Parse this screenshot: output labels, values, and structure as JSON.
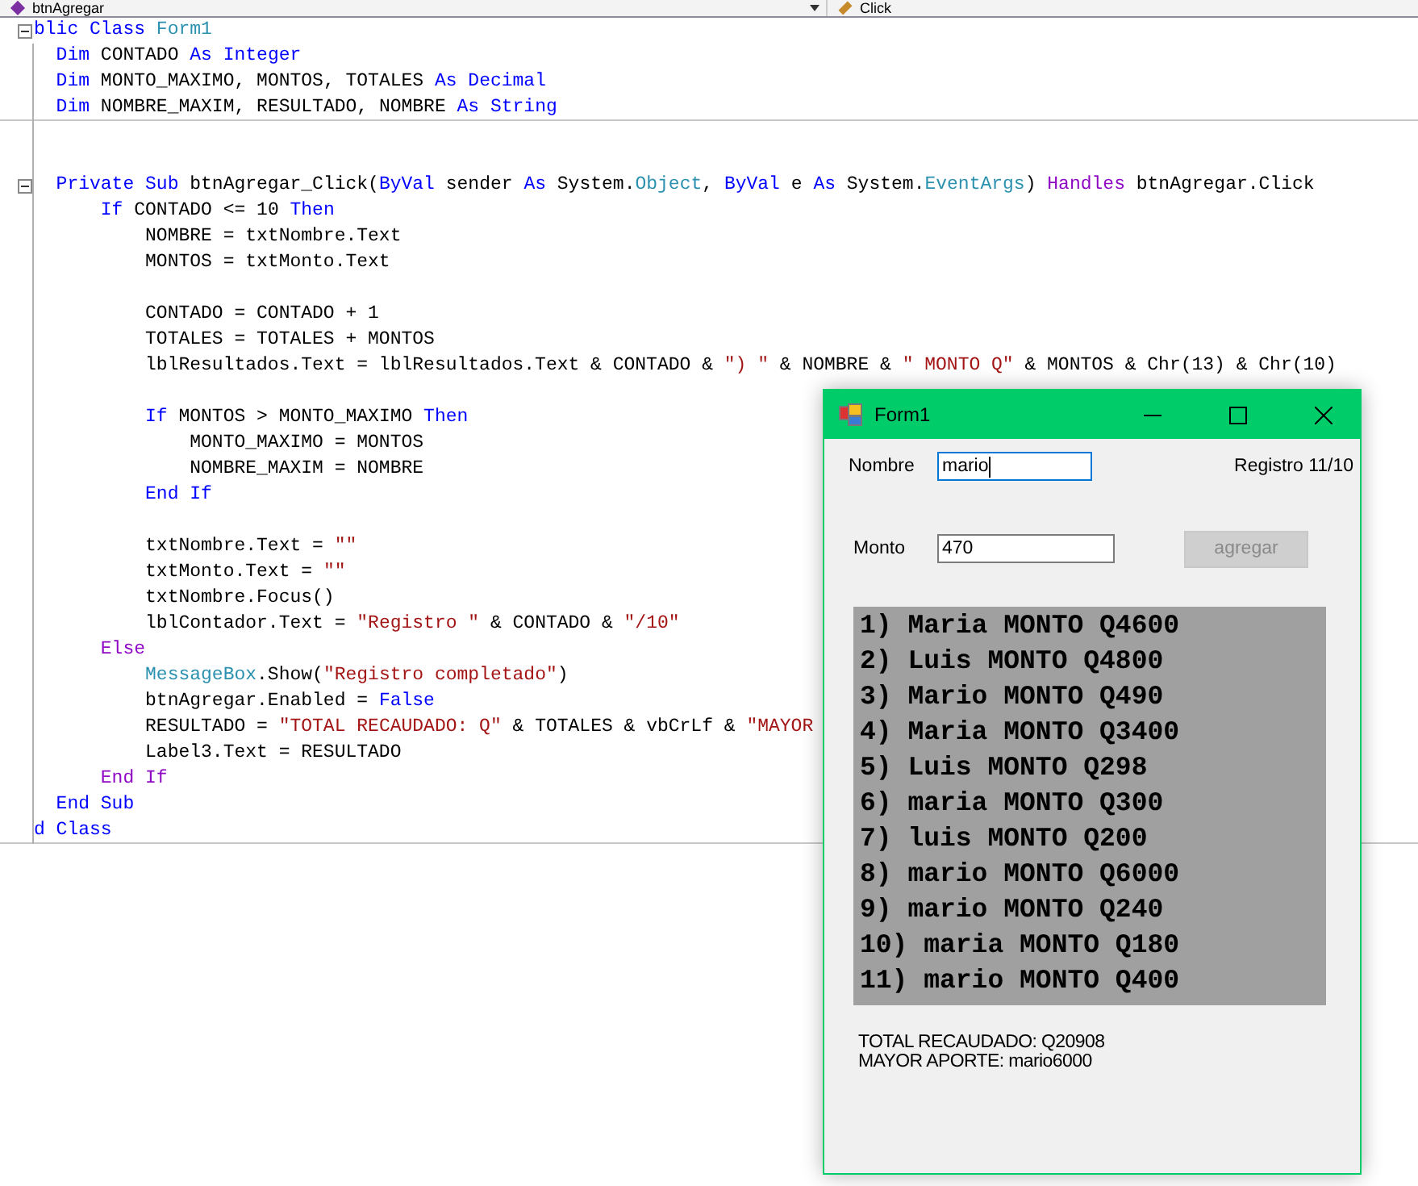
{
  "navigation": [
    {
      "text": "btnAgregar"
    },
    {
      "text": "Click"
    }
  ],
  "editor": {
    "lines": [
      {
        "kind": "code",
        "fold": true,
        "rule_below": false,
        "tokens": [
          {
            "kind": "keyword",
            "text": "blic Class "
          },
          {
            "kind": "type",
            "text": "Form1"
          }
        ]
      },
      {
        "kind": "code",
        "fold": false,
        "rule_below": false,
        "tokens": [
          {
            "kind": "keyword",
            "text": "  Dim "
          },
          {
            "kind": "plain",
            "text": "CONTADO "
          },
          {
            "kind": "keyword",
            "text": "As Integer"
          }
        ]
      },
      {
        "kind": "code",
        "fold": false,
        "rule_below": false,
        "tokens": [
          {
            "kind": "keyword",
            "text": "  Dim "
          },
          {
            "kind": "plain",
            "text": "MONTO_MAXIMO, MONTOS, TOTALES "
          },
          {
            "kind": "keyword",
            "text": "As Decimal"
          }
        ]
      },
      {
        "kind": "code",
        "fold": false,
        "rule_below": true,
        "tokens": [
          {
            "kind": "keyword",
            "text": "  Dim "
          },
          {
            "kind": "plain",
            "text": "NOMBRE_MAXIM, RESULTADO, NOMBRE "
          },
          {
            "kind": "keyword",
            "text": "As String"
          }
        ]
      },
      {
        "kind": "blank"
      },
      {
        "kind": "blank"
      },
      {
        "kind": "code",
        "fold": true,
        "rule_below": false,
        "tokens": [
          {
            "kind": "keyword",
            "text": "  Private Sub "
          },
          {
            "kind": "plain",
            "text": "btnAgregar_Click("
          },
          {
            "kind": "keyword",
            "text": "ByVal "
          },
          {
            "kind": "plain",
            "text": "sender "
          },
          {
            "kind": "keyword",
            "text": "As "
          },
          {
            "kind": "plain",
            "text": "System."
          },
          {
            "kind": "type",
            "text": "Object"
          },
          {
            "kind": "plain",
            "text": ", "
          },
          {
            "kind": "keyword",
            "text": "ByVal "
          },
          {
            "kind": "plain",
            "text": "e "
          },
          {
            "kind": "keyword",
            "text": "As "
          },
          {
            "kind": "plain",
            "text": "System."
          },
          {
            "kind": "type",
            "text": "EventArgs"
          },
          {
            "kind": "plain",
            "text": ") "
          },
          {
            "kind": "control",
            "text": "Handles "
          },
          {
            "kind": "plain",
            "text": "btnAgregar.Click"
          }
        ]
      },
      {
        "kind": "code",
        "fold": false,
        "rule_below": false,
        "tokens": [
          {
            "kind": "keyword",
            "text": "      If "
          },
          {
            "kind": "plain",
            "text": "CONTADO <= 10 "
          },
          {
            "kind": "keyword",
            "text": "Then"
          }
        ]
      },
      {
        "kind": "code",
        "fold": false,
        "rule_below": false,
        "tokens": [
          {
            "kind": "plain",
            "text": "          NOMBRE = txtNombre.Text"
          }
        ]
      },
      {
        "kind": "code",
        "fold": false,
        "rule_below": false,
        "tokens": [
          {
            "kind": "plain",
            "text": "          MONTOS = txtMonto.Text"
          }
        ]
      },
      {
        "kind": "blank"
      },
      {
        "kind": "code",
        "fold": false,
        "rule_below": false,
        "tokens": [
          {
            "kind": "plain",
            "text": "          CONTADO = CONTADO + 1"
          }
        ]
      },
      {
        "kind": "code",
        "fold": false,
        "rule_below": false,
        "tokens": [
          {
            "kind": "plain",
            "text": "          TOTALES = TOTALES + MONTOS"
          }
        ]
      },
      {
        "kind": "code",
        "fold": false,
        "rule_below": false,
        "tokens": [
          {
            "kind": "plain",
            "text": "          lblResultados.Text = lblResultados.Text & CONTADO & "
          },
          {
            "kind": "string",
            "text": "\") \""
          },
          {
            "kind": "plain",
            "text": " & NOMBRE & "
          },
          {
            "kind": "string",
            "text": "\" MONTO Q\""
          },
          {
            "kind": "plain",
            "text": " & MONTOS & Chr(13) & Chr(10)"
          }
        ]
      },
      {
        "kind": "blank"
      },
      {
        "kind": "code",
        "fold": false,
        "rule_below": false,
        "tokens": [
          {
            "kind": "keyword",
            "text": "          If "
          },
          {
            "kind": "plain",
            "text": "MONTOS > MONTO_MAXIMO "
          },
          {
            "kind": "keyword",
            "text": "Then"
          }
        ]
      },
      {
        "kind": "code",
        "fold": false,
        "rule_below": false,
        "tokens": [
          {
            "kind": "plain",
            "text": "              MONTO_MAXIMO = MONTOS"
          }
        ]
      },
      {
        "kind": "code",
        "fold": false,
        "rule_below": false,
        "tokens": [
          {
            "kind": "plain",
            "text": "              NOMBRE_MAXIM = NOMBRE"
          }
        ]
      },
      {
        "kind": "code",
        "fold": false,
        "rule_below": false,
        "tokens": [
          {
            "kind": "keyword",
            "text": "          End If"
          }
        ]
      },
      {
        "kind": "blank"
      },
      {
        "kind": "code",
        "fold": false,
        "rule_below": false,
        "tokens": [
          {
            "kind": "plain",
            "text": "          txtNombre.Text = "
          },
          {
            "kind": "string",
            "text": "\"\""
          }
        ]
      },
      {
        "kind": "code",
        "fold": false,
        "rule_below": false,
        "tokens": [
          {
            "kind": "plain",
            "text": "          txtMonto.Text = "
          },
          {
            "kind": "string",
            "text": "\"\""
          }
        ]
      },
      {
        "kind": "code",
        "fold": false,
        "rule_below": false,
        "tokens": [
          {
            "kind": "plain",
            "text": "          txtNombre.Focus()"
          }
        ]
      },
      {
        "kind": "code",
        "fold": false,
        "rule_below": false,
        "tokens": [
          {
            "kind": "plain",
            "text": "          lblContador.Text = "
          },
          {
            "kind": "string",
            "text": "\"Registro \""
          },
          {
            "kind": "plain",
            "text": " & CONTADO & "
          },
          {
            "kind": "string",
            "text": "\"/10\""
          }
        ]
      },
      {
        "kind": "code",
        "fold": false,
        "rule_below": false,
        "tokens": [
          {
            "kind": "control",
            "text": "      Else"
          }
        ]
      },
      {
        "kind": "code",
        "fold": false,
        "rule_below": false,
        "tokens": [
          {
            "kind": "type",
            "text": "          MessageBox"
          },
          {
            "kind": "plain",
            "text": ".Show("
          },
          {
            "kind": "string",
            "text": "\"Registro completado\""
          },
          {
            "kind": "plain",
            "text": ")"
          }
        ]
      },
      {
        "kind": "code",
        "fold": false,
        "rule_below": false,
        "tokens": [
          {
            "kind": "plain",
            "text": "          btnAgregar.Enabled = "
          },
          {
            "kind": "keyword",
            "text": "False"
          }
        ]
      },
      {
        "kind": "code",
        "fold": false,
        "rule_below": false,
        "tokens": [
          {
            "kind": "plain",
            "text": "          RESULTADO = "
          },
          {
            "kind": "string",
            "text": "\"TOTAL RECAUDADO: Q\""
          },
          {
            "kind": "plain",
            "text": " & TOTALES & vbCrLf & "
          },
          {
            "kind": "string",
            "text": "\"MAYOR"
          }
        ]
      },
      {
        "kind": "code",
        "fold": false,
        "rule_below": false,
        "tokens": [
          {
            "kind": "plain",
            "text": "          Label3.Text = RESULTADO"
          }
        ]
      },
      {
        "kind": "code",
        "fold": false,
        "rule_below": false,
        "tokens": [
          {
            "kind": "control",
            "text": "      End If"
          }
        ]
      },
      {
        "kind": "code",
        "fold": false,
        "rule_below": false,
        "tokens": [
          {
            "kind": "keyword",
            "text": "  End Sub"
          }
        ]
      },
      {
        "kind": "code",
        "fold": false,
        "rule_below": true,
        "tokens": [
          {
            "kind": "keyword",
            "text": "d Class"
          }
        ]
      }
    ]
  },
  "form_window": {
    "title": "Form1",
    "nombre": {
      "label": "Nombre",
      "value": "mario",
      "focused": true
    },
    "counter": "Registro 11/10",
    "monto": {
      "label": "Monto",
      "value": "470",
      "focused": false
    },
    "add_button": {
      "label": "agregar",
      "disabled": true
    },
    "results": [
      "1) Maria MONTO Q4600",
      "2) Luis MONTO Q4800",
      "3) Mario MONTO Q490",
      "4) Maria MONTO Q3400",
      "5) Luis MONTO Q298",
      "6) maria MONTO Q300",
      "7) luis MONTO Q200",
      "8) mario MONTO Q6000",
      "9) mario MONTO Q240",
      "10) maria MONTO Q180",
      "11) mario MONTO Q400"
    ],
    "summary": [
      "TOTAL RECAUDADO: Q20908",
      "MAYOR APORTE: mario6000"
    ]
  }
}
